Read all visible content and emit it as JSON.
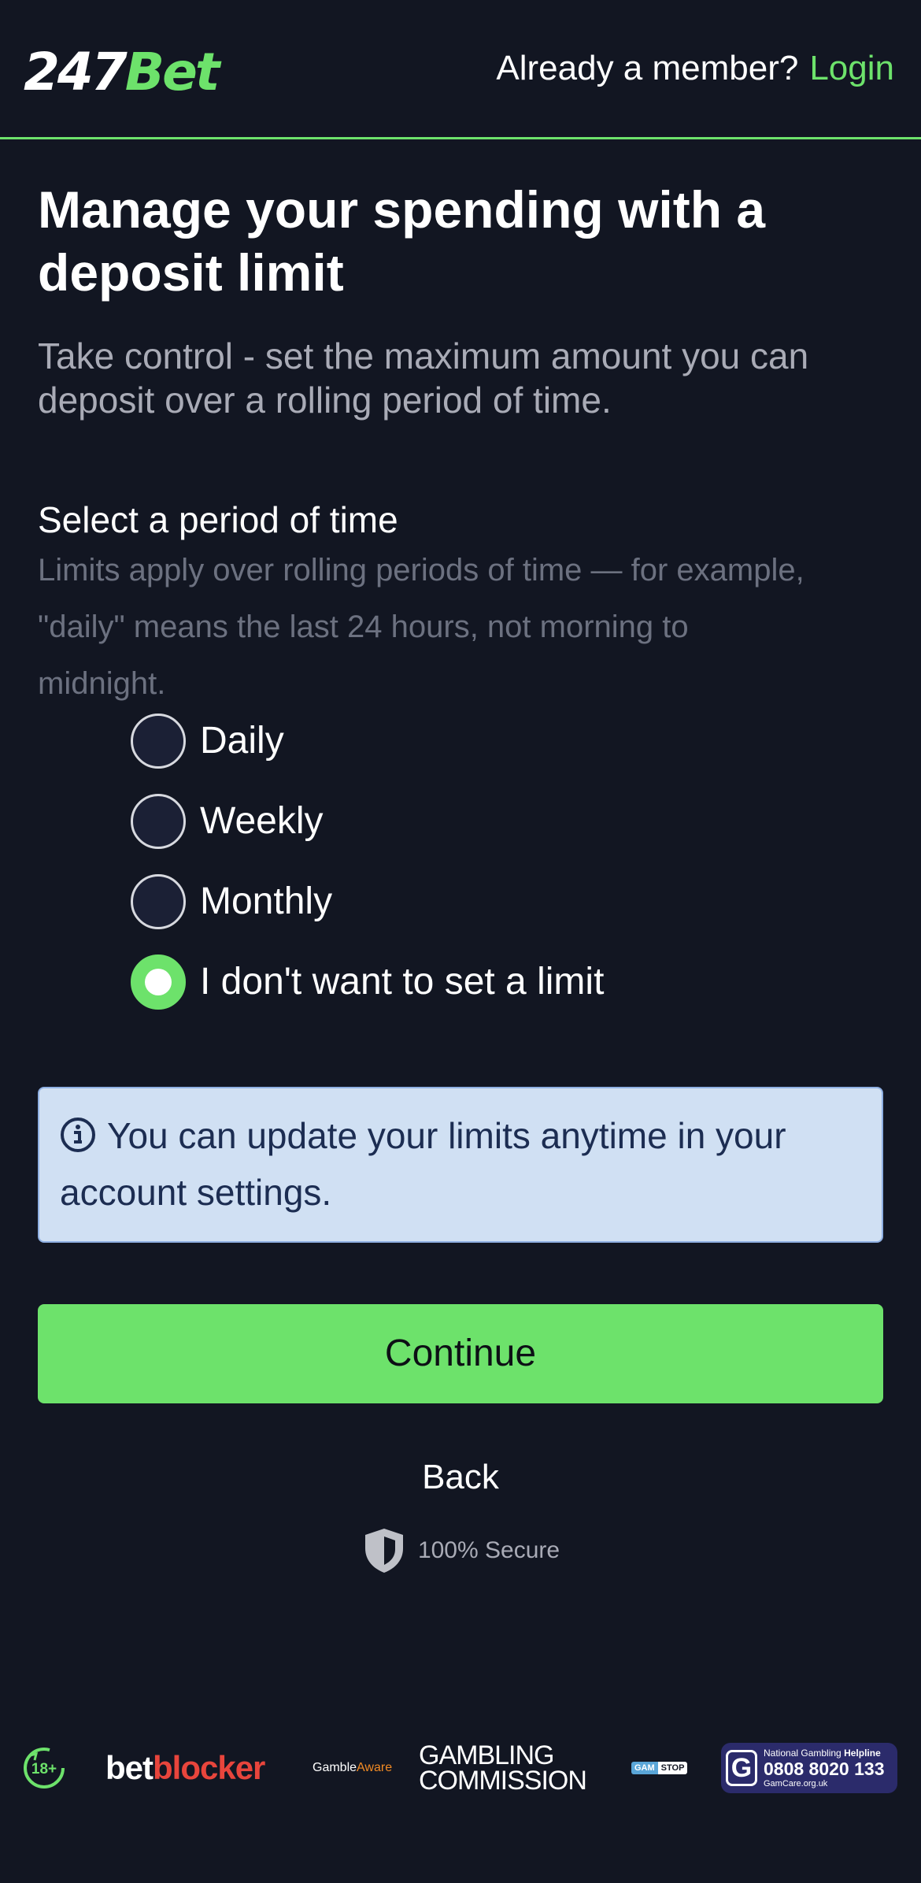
{
  "header": {
    "logo_number": "247",
    "logo_word": "Bet",
    "member_prompt": "Already a member?",
    "login_label": "Login"
  },
  "main": {
    "title": "Manage your spending with a deposit limit",
    "subtitle": "Take control - set the maximum amount you can deposit over a rolling period of time.",
    "period_label": "Select a period of time",
    "period_hint": "Limits apply over rolling periods of time — for example, \"daily\" means the last 24 hours, not morning to midnight.",
    "options": [
      {
        "label": "Daily",
        "checked": false
      },
      {
        "label": "Weekly",
        "checked": false
      },
      {
        "label": "Monthly",
        "checked": false
      },
      {
        "label": "I don't want to set a limit",
        "checked": true
      }
    ],
    "info_text": "You can update your limits anytime in your account settings.",
    "continue_label": "Continue",
    "back_label": "Back",
    "secure_text": "100% Secure"
  },
  "footer": {
    "age_badge": "18+",
    "betblocker_part1": "bet",
    "betblocker_part2": "blocker",
    "gambleaware_part1": "Gamble",
    "gambleaware_part2": "Aware",
    "commission_line1": "GAMBLING",
    "commission_line2": "COMMISSION",
    "gamstop_part1": "GAM",
    "gamstop_part2": "STOP",
    "helpline_title_regular": "National Gambling ",
    "helpline_title_bold": "Helpline",
    "helpline_number": "0808 8020 133",
    "helpline_site": "GamCare.org.uk"
  },
  "colors": {
    "background": "#121622",
    "accent": "#6de26b",
    "info_background": "#d0e0f3",
    "muted_text": "#a9abb6"
  },
  "icons": {
    "info": "info-circle-icon",
    "secure": "shield-icon",
    "age": "age-18-icon"
  }
}
